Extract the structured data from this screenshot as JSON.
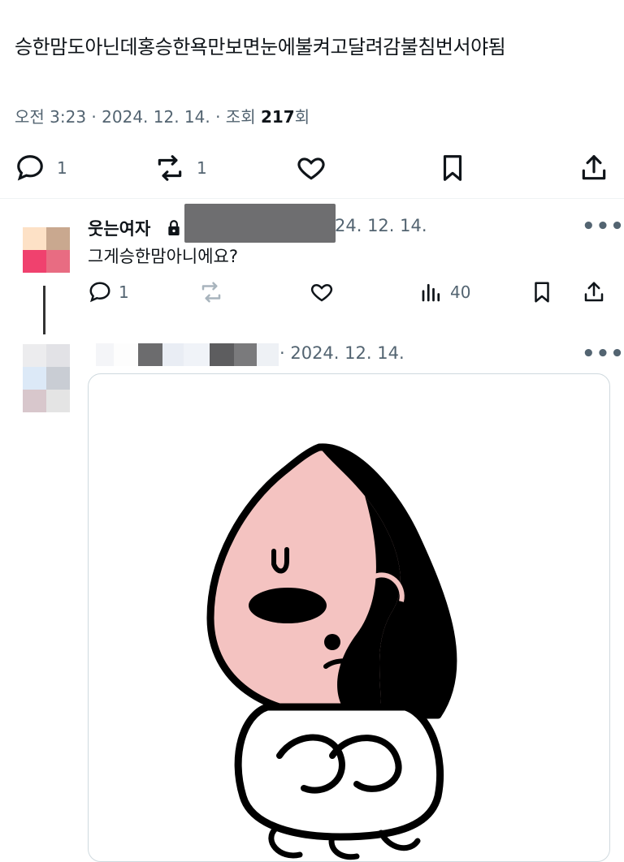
{
  "post": {
    "text": "승한맘도아닌데홍승한욕만보면눈에불켜고달려감불침번서야됨",
    "meta": {
      "time_date": "오전 3:23 · 2024. 12. 14. · 조회 ",
      "views": "217",
      "views_suffix": "회"
    },
    "actions": {
      "reply_count": "1",
      "retweet_count": "1"
    }
  },
  "reply1": {
    "author": "웃는여자",
    "date": "24. 12. 14.",
    "text": "그게승한맘아니에요?",
    "reply_count": "1",
    "views": "40",
    "more": "•••"
  },
  "reply2": {
    "date": "· 2024. 12. 14.",
    "more": "•••"
  }
}
